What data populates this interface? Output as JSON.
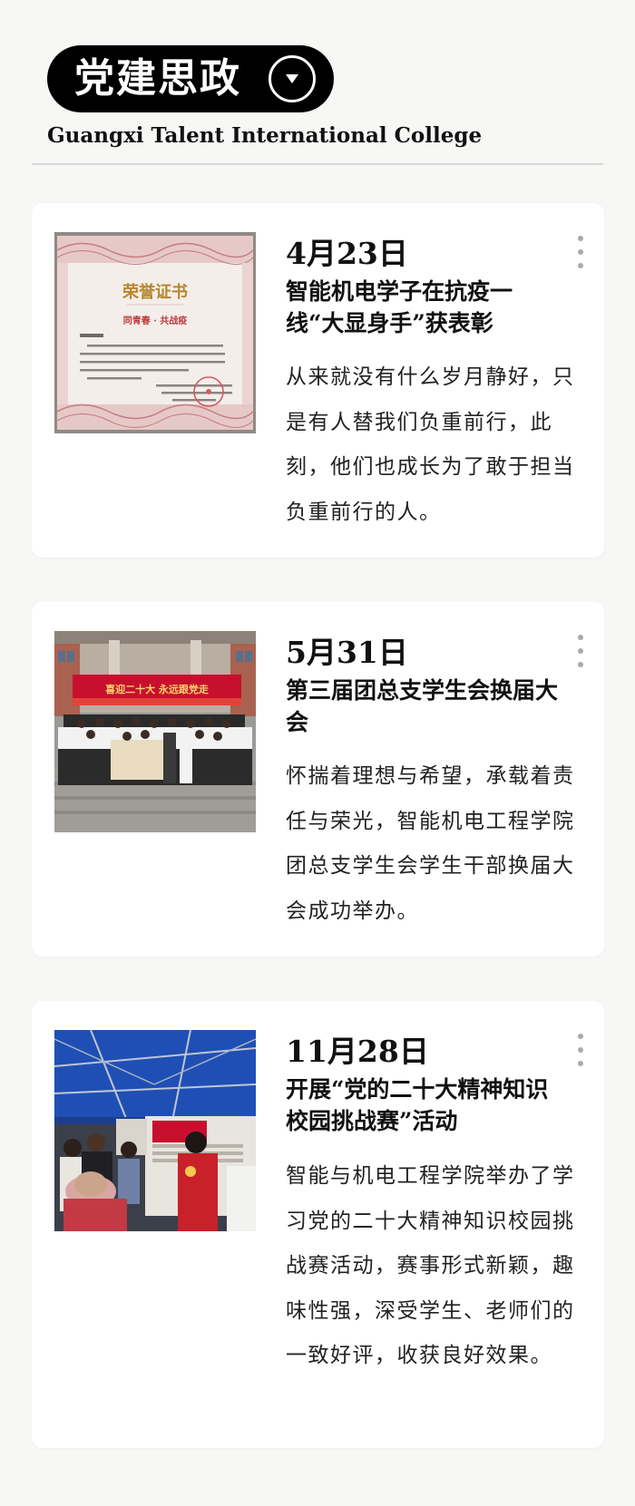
{
  "header": {
    "title": "党建思政",
    "subtitle": "Guangxi Talent International College"
  },
  "image_text": {
    "certificate_title": "荣誉证书",
    "certificate_slogan": "同青春 · 共战疫",
    "banner_text": "喜迎二十大 永远跟党走"
  },
  "articles": [
    {
      "date": "4月23日",
      "title": "智能机电学子在抗疫一线“大显身手”获表彰",
      "description": "从来就没有什么岁月静好，只是有人替我们负重前行，此刻，他们也成长为了敢于担当负重前行的人。",
      "image_icon": "honor-certificate-image"
    },
    {
      "date": "5月31日",
      "title": "第三届团总支学生会换届大会",
      "description": "怀揣着理想与希望，承载着责任与荣光，智能机电工程学院团总支学生会学生干部换届大会成功举办。",
      "image_icon": "group-photo-image"
    },
    {
      "date": "11月28日",
      "title": "开展“党的二十大精神知识校园挑战赛”活动",
      "description": "智能与机电工程学院举办了学习党的二十大精神知识校园挑战赛活动，赛事形式新颖，趣味性强，深受学生、老师们的一致好评，收获良好效果。",
      "image_icon": "outdoor-event-image"
    }
  ],
  "colors": {
    "background": "#f7f7f5",
    "card": "#ffffff",
    "pill": "#000000",
    "text": "#111111",
    "accent_red": "#c8102e"
  }
}
